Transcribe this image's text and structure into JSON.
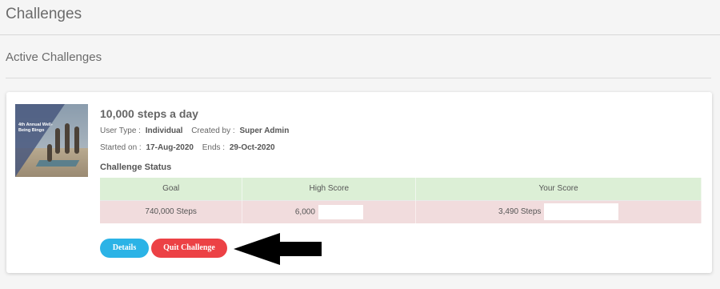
{
  "page": {
    "title": "Challenges"
  },
  "section": {
    "title": "Active Challenges"
  },
  "challenge": {
    "image_caption": "4th Annual Well-Being Bingo",
    "name": "10,000 steps a day",
    "user_type_label": "User Type :",
    "user_type": "Individual",
    "created_by_label": "Created by :",
    "created_by": "Super Admin",
    "started_label": "Started on :",
    "started_on": "17-Aug-2020",
    "ends_label": "Ends :",
    "ends": "29-Oct-2020",
    "status_title": "Challenge Status",
    "status_table": {
      "headers": [
        "Goal",
        "High Score",
        "Your Score"
      ],
      "goal": "740,000 Steps",
      "high_score": "6,000",
      "your_score": "3,490 Steps"
    },
    "buttons": {
      "details": "Details",
      "quit": "Quit Challenge"
    }
  },
  "colors": {
    "details_button": "#2bb3e6",
    "quit_button": "#ec4145",
    "header_row": "#dcefd6",
    "value_row": "#f1dcdd",
    "annotation_arrow": "#000000"
  },
  "icons": {
    "annotation": "black-arrow-left-icon"
  }
}
